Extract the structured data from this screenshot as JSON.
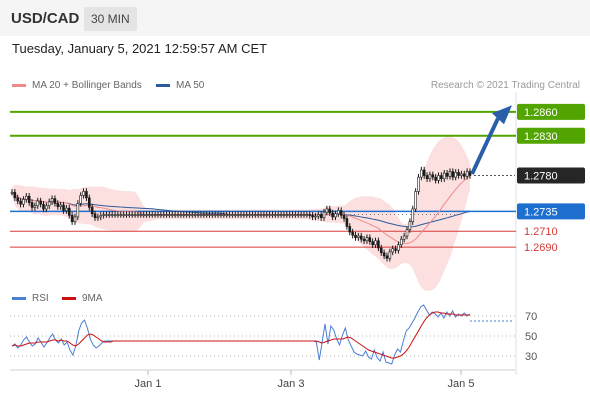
{
  "header": {
    "symbol": "USD/CAD",
    "timeframe": "30 MIN",
    "datetime": "Tuesday, January 5, 2021 12:59:57 AM CET"
  },
  "legend": {
    "ma20": "MA 20 + Bollinger Bands",
    "ma50": "MA 50",
    "rsi": "RSI",
    "ma9": "9MA",
    "credit": "Research © 2021 Trading Central"
  },
  "colors": {
    "resistance": "#52a400",
    "support": "#d63b3b",
    "pivot": "#1f6fd1",
    "ma20": "#f08a8a",
    "ma50": "#2d5a9a",
    "rsi": "#4a7fd4",
    "ma9": "#cc1111",
    "candle": "#1a1a1a"
  },
  "chart_data": [
    {
      "type": "candlestick",
      "title": "USD/CAD",
      "xlabel": "",
      "ylabel": "",
      "x_ticks": [
        "Jan 1",
        "Jan 3",
        "Jan 5"
      ],
      "levels": [
        {
          "value": 1.286,
          "label": "1.2860",
          "kind": "resistance"
        },
        {
          "value": 1.283,
          "label": "1.2830",
          "kind": "resistance"
        },
        {
          "value": 1.278,
          "label": "1.2780",
          "kind": "last"
        },
        {
          "value": 1.2735,
          "label": "1.2735",
          "kind": "pivot"
        },
        {
          "value": 1.271,
          "label": "1.2710",
          "kind": "support"
        },
        {
          "value": 1.269,
          "label": "1.2690",
          "kind": "support"
        }
      ],
      "close": [
        1.2759,
        1.2752,
        1.2748,
        1.2744,
        1.275,
        1.2754,
        1.2746,
        1.274,
        1.2742,
        1.2748,
        1.2744,
        1.2738,
        1.2742,
        1.2747,
        1.2751,
        1.2745,
        1.2741,
        1.2743,
        1.2736,
        1.2739,
        1.273,
        1.2722,
        1.2728,
        1.2745,
        1.2755,
        1.276,
        1.2752,
        1.274,
        1.2732,
        1.2727,
        1.2728,
        1.273,
        1.2731,
        1.2731,
        1.2731,
        1.2731,
        1.2731,
        1.2731,
        1.2731,
        1.2731,
        1.2731,
        1.2731,
        1.2731,
        1.2731,
        1.2731,
        1.2731,
        1.2731,
        1.2731,
        1.2731,
        1.2731,
        1.2731,
        1.2731,
        1.2731,
        1.2731,
        1.2731,
        1.2731,
        1.2731,
        1.2731,
        1.2731,
        1.2731,
        1.2731,
        1.2731,
        1.2731,
        1.2731,
        1.2731,
        1.2731,
        1.2731,
        1.2731,
        1.2731,
        1.2731,
        1.2731,
        1.2731,
        1.2731,
        1.2731,
        1.2731,
        1.2731,
        1.2731,
        1.2731,
        1.2731,
        1.2731,
        1.2731,
        1.2731,
        1.2731,
        1.2731,
        1.2731,
        1.2731,
        1.2731,
        1.2731,
        1.2731,
        1.2731,
        1.2731,
        1.2731,
        1.2731,
        1.2731,
        1.2731,
        1.2731,
        1.2731,
        1.2731,
        1.2731,
        1.2731,
        1.2731,
        1.2731,
        1.2731,
        1.2731,
        1.273,
        1.2728,
        1.2729,
        1.2731,
        1.2727,
        1.2734,
        1.2738,
        1.2733,
        1.2728,
        1.2732,
        1.2736,
        1.273,
        1.2726,
        1.2716,
        1.2709,
        1.2705,
        1.2702,
        1.2704,
        1.27,
        1.2698,
        1.2702,
        1.2697,
        1.2693,
        1.2698,
        1.2689,
        1.2683,
        1.2679,
        1.2676,
        1.2684,
        1.2688,
        1.2686,
        1.2693,
        1.27,
        1.2704,
        1.2712,
        1.2722,
        1.2738,
        1.276,
        1.2778,
        1.2787,
        1.278,
        1.2776,
        1.2781,
        1.2778,
        1.2774,
        1.278,
        1.2776,
        1.2783,
        1.2779,
        1.2785,
        1.2778,
        1.2784,
        1.278,
        1.2782,
        1.2779,
        1.2785,
        1.278
      ],
      "ylim": [
        1.2655,
        1.2885
      ]
    },
    {
      "type": "line",
      "title": "RSI",
      "ticks": [
        70,
        50,
        30
      ],
      "ylim": [
        20,
        80
      ],
      "series": [
        {
          "name": "RSI",
          "values": [
            40,
            42,
            38,
            41,
            46,
            49,
            44,
            40,
            42,
            48,
            44,
            39,
            43,
            48,
            52,
            46,
            43,
            47,
            41,
            44,
            36,
            31,
            40,
            55,
            63,
            66,
            58,
            47,
            41,
            38,
            40,
            43,
            45,
            45,
            45,
            45,
            45,
            45,
            45,
            45,
            45,
            45,
            45,
            45,
            45,
            45,
            45,
            45,
            45,
            45,
            45,
            45,
            45,
            45,
            45,
            45,
            45,
            45,
            45,
            45,
            45,
            45,
            45,
            45,
            45,
            45,
            45,
            45,
            45,
            45,
            45,
            45,
            45,
            45,
            45,
            45,
            45,
            45,
            45,
            45,
            45,
            45,
            45,
            45,
            45,
            45,
            45,
            45,
            45,
            45,
            45,
            45,
            45,
            45,
            45,
            45,
            45,
            45,
            45,
            45,
            45,
            45,
            45,
            45,
            45,
            44,
            26,
            44,
            62,
            42,
            60,
            56,
            47,
            41,
            51,
            58,
            46,
            40,
            34,
            32,
            31,
            30,
            35,
            29,
            27,
            36,
            28,
            25,
            34,
            24,
            23,
            22,
            31,
            37,
            34,
            45,
            55,
            58,
            63,
            68,
            74,
            79,
            81,
            76,
            71,
            74,
            72,
            69,
            73,
            68,
            74,
            70,
            75,
            69,
            72,
            70,
            73,
            70,
            72
          ]
        },
        {
          "name": "9MA",
          "values": [
            40,
            41,
            40,
            40,
            41,
            42,
            43,
            43,
            43,
            44,
            44,
            44,
            44,
            45,
            46,
            46,
            45,
            46,
            45,
            45,
            43,
            41,
            40,
            42,
            45,
            48,
            51,
            52,
            51,
            49,
            47,
            45,
            44,
            44,
            44,
            45,
            45,
            45,
            45,
            45,
            45,
            45,
            45,
            45,
            45,
            45,
            45,
            45,
            45,
            45,
            45,
            45,
            45,
            45,
            45,
            45,
            45,
            45,
            45,
            45,
            45,
            45,
            45,
            45,
            45,
            45,
            45,
            45,
            45,
            45,
            45,
            45,
            45,
            45,
            45,
            45,
            45,
            45,
            45,
            45,
            45,
            45,
            45,
            45,
            45,
            45,
            45,
            45,
            45,
            45,
            45,
            45,
            45,
            45,
            45,
            45,
            45,
            45,
            45,
            45,
            45,
            45,
            45,
            45,
            45,
            45,
            44,
            43,
            44,
            45,
            46,
            47,
            47,
            47,
            47,
            48,
            49,
            48,
            46,
            44,
            42,
            40,
            38,
            36,
            35,
            34,
            33,
            32,
            31,
            30,
            29,
            28,
            28,
            29,
            30,
            32,
            35,
            39,
            44,
            49,
            54,
            59,
            64,
            68,
            71,
            73,
            74,
            74,
            73,
            73,
            72,
            72,
            72,
            71,
            71,
            71,
            71,
            71,
            71
          ]
        }
      ],
      "dashed_level": 65
    }
  ]
}
